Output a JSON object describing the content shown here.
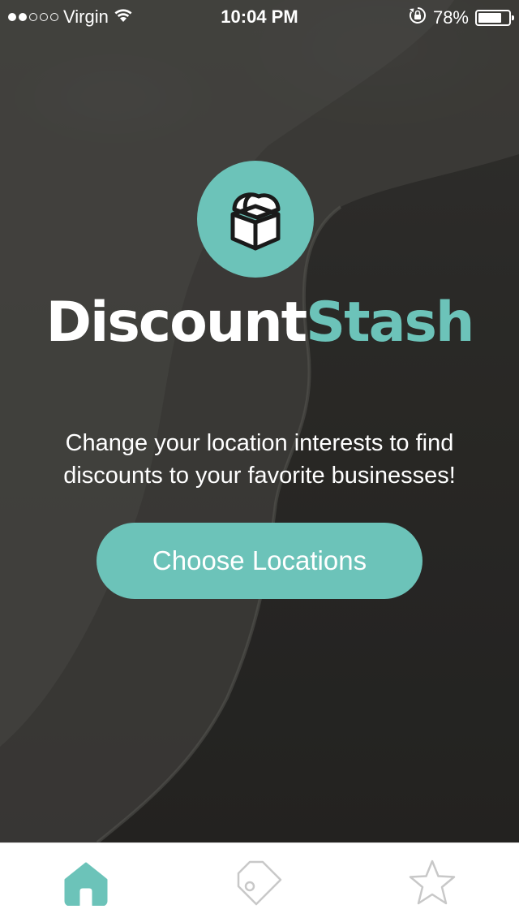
{
  "status_bar": {
    "carrier": "Virgin",
    "time": "10:04 PM",
    "battery_percent": "78%",
    "battery_level": 0.78,
    "signal_strength": 2,
    "signal_total": 5
  },
  "app": {
    "logo_icon": "treasure-chest-icon",
    "name_part1": "Discount",
    "name_part2": "Stash"
  },
  "main": {
    "tagline_line1": "Change your location interests to find",
    "tagline_line2": "discounts to your favorite businesses!",
    "choose_locations_label": "Choose Locations"
  },
  "tab_bar": {
    "items": [
      {
        "icon": "home-icon",
        "active": true
      },
      {
        "icon": "tag-icon",
        "active": false
      },
      {
        "icon": "star-icon",
        "active": false
      }
    ]
  },
  "colors": {
    "accent": "#6cc3b9",
    "tab_inactive": "#c8c8c8",
    "text_light": "#ffffff"
  }
}
